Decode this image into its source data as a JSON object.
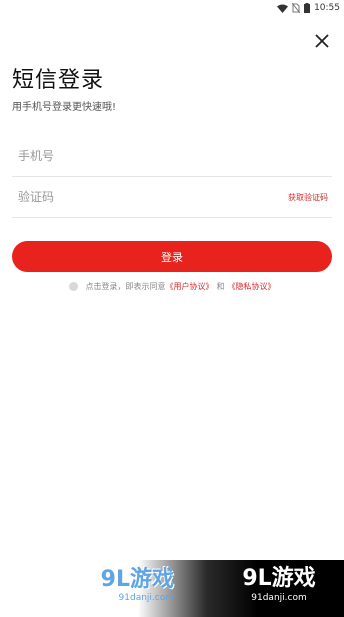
{
  "status_bar": {
    "time": "10:55",
    "icons": [
      "wifi-icon",
      "no-sim-icon",
      "battery-icon"
    ]
  },
  "header": {
    "title": "短信登录",
    "subtitle": "用手机号登录更快速哦!"
  },
  "form": {
    "phone_placeholder": "手机号",
    "code_placeholder": "验证码",
    "get_code_label": "获取验证码",
    "login_label": "登录"
  },
  "agreement": {
    "prefix": "点击登录，即表示同意",
    "user_agreement": "《用户协议》",
    "conjunction": "和",
    "privacy_agreement": "《隐私协议》"
  },
  "watermark": {
    "brand": "9L游戏",
    "domain": "91danji.com"
  },
  "colors": {
    "accent": "#e8221c",
    "link": "#d52b2b",
    "watermark_blue": "#5ea4e6"
  }
}
